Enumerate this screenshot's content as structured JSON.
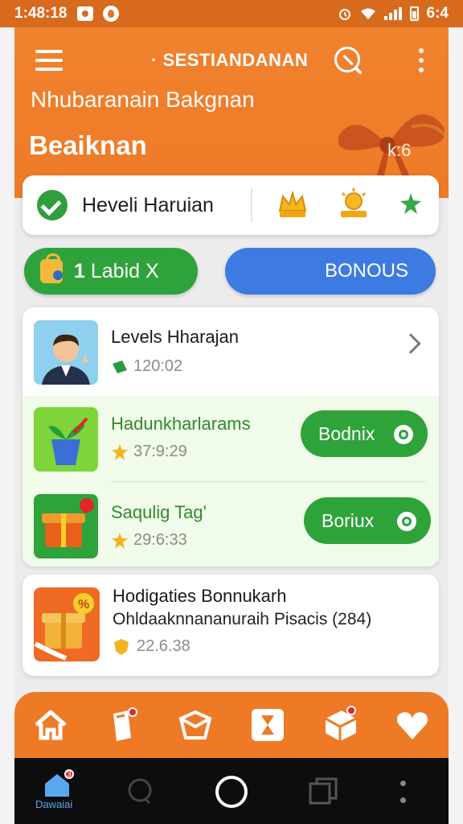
{
  "status_bar": {
    "time": "1:48:18",
    "battery_text": "6:4",
    "icons": [
      "notification-box-icon",
      "flame-icon",
      "alarm-icon",
      "wifi-icon",
      "signal-icon",
      "battery-icon"
    ]
  },
  "header": {
    "app_title": "· SESTIANDANAN",
    "subtitle": "Nhubaranain Bakgnan",
    "title": "Beaiknan",
    "corner_text": "k:6",
    "menu_icon": "hamburger-icon",
    "search_icon": "search-icon",
    "more_icon": "more-vert-icon"
  },
  "level_card": {
    "label": "Heveli Haruian",
    "icons": [
      "check-circle-icon",
      "crown-icon",
      "sun-badge-icon",
      "green-star-icon"
    ]
  },
  "pills": {
    "left": {
      "count": "1",
      "label": " Labid ",
      "suffix": "X"
    },
    "right": {
      "label": "BONOUS"
    }
  },
  "list": {
    "items": [
      {
        "title": "Levels Hharajan",
        "meta": "120:02",
        "action": "chevron"
      },
      {
        "title": "Hadunkharlarams",
        "meta": "37:9:29",
        "action_label": "Bodnix"
      },
      {
        "title": "Saqulig Tag'",
        "meta": "29:6:33",
        "action_label": "Boriux"
      }
    ]
  },
  "promo": {
    "title": "Hodigaties Bonnukarh",
    "subtitle": "Ohldaaknnananuraih Pisacis (284)",
    "meta": "22.6.38"
  },
  "bottom_tabs": [
    "home-icon",
    "tag-icon",
    "gift-box-icon",
    "hourglass-icon",
    "package-icon",
    "heart-icon"
  ],
  "nav": {
    "home_label": "Dawaiai",
    "home_badge": "3"
  },
  "colors": {
    "brand_orange": "#ee7a26",
    "green": "#2fa33b",
    "blue": "#3d7be3"
  }
}
